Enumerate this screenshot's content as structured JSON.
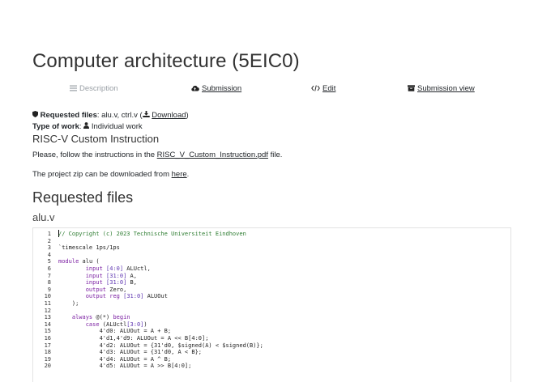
{
  "page": {
    "title": "Computer architecture (5EIC0)"
  },
  "tabs": [
    {
      "label": "Description",
      "icon": "list-icon",
      "disabled": true
    },
    {
      "label": "Submission",
      "icon": "cloud-upload-icon",
      "disabled": false
    },
    {
      "label": "Edit",
      "icon": "code-icon",
      "disabled": false
    },
    {
      "label": "Submission view",
      "icon": "archive-icon",
      "disabled": false
    }
  ],
  "meta": {
    "requested_files_label": "Requested files",
    "requested_files_value": ": alu.v, ctrl.v (",
    "download_label": "Download",
    "close_paren": ")",
    "type_of_work_label": "Type of work",
    "type_of_work_value": "Individual work"
  },
  "project": {
    "title": "RISC-V Custom Instruction",
    "instructions_prefix": "Please, follow the instructions in the ",
    "instructions_link": "RISC_V_Custom_Instruction.pdf",
    "instructions_suffix": " file.",
    "zip_prefix": "The project zip can be downloaded from ",
    "zip_link": "here",
    "zip_suffix": "."
  },
  "section": {
    "title": "Requested files"
  },
  "file": {
    "name": "alu.v",
    "lines": [
      {
        "n": "1",
        "text": "// Copyright (c) 2023 Technische Universiteit Eindhoven",
        "cls": "cmt"
      },
      {
        "n": "2",
        "text": "",
        "cls": ""
      },
      {
        "n": "3",
        "text": "`timescale 1ps/1ps",
        "cls": ""
      },
      {
        "n": "4",
        "text": "",
        "cls": ""
      },
      {
        "n": "5",
        "text": "module alu (",
        "cls": ""
      },
      {
        "n": "6",
        "text": "        input [4:0] ALUctl,",
        "cls": ""
      },
      {
        "n": "7",
        "text": "        input [31:0] A,",
        "cls": ""
      },
      {
        "n": "8",
        "text": "        input [31:0] B,",
        "cls": ""
      },
      {
        "n": "9",
        "text": "        output Zero,",
        "cls": ""
      },
      {
        "n": "10",
        "text": "        output reg [31:0] ALUOut",
        "cls": ""
      },
      {
        "n": "11",
        "text": "    );",
        "cls": ""
      },
      {
        "n": "12",
        "text": "",
        "cls": ""
      },
      {
        "n": "13",
        "text": "    always @(*) begin",
        "cls": ""
      },
      {
        "n": "14",
        "text": "        case (ALUctl[3:0])",
        "cls": ""
      },
      {
        "n": "15",
        "text": "            4'd0: ALUOut = A + B;",
        "cls": ""
      },
      {
        "n": "16",
        "text": "            4'd1,4'd9: ALUOut = A << B[4:0];",
        "cls": ""
      },
      {
        "n": "17",
        "text": "            4'd2: ALUOut = {31'd0, $signed(A) < $signed(B)};",
        "cls": ""
      },
      {
        "n": "18",
        "text": "            4'd3: ALUOut = {31'd0, A < B};",
        "cls": ""
      },
      {
        "n": "19",
        "text": "            4'd4: ALUOut = A ^ B;",
        "cls": ""
      },
      {
        "n": "20",
        "text": "            4'd5: ALUOut = A >> B[4:0];",
        "cls": ""
      }
    ]
  }
}
